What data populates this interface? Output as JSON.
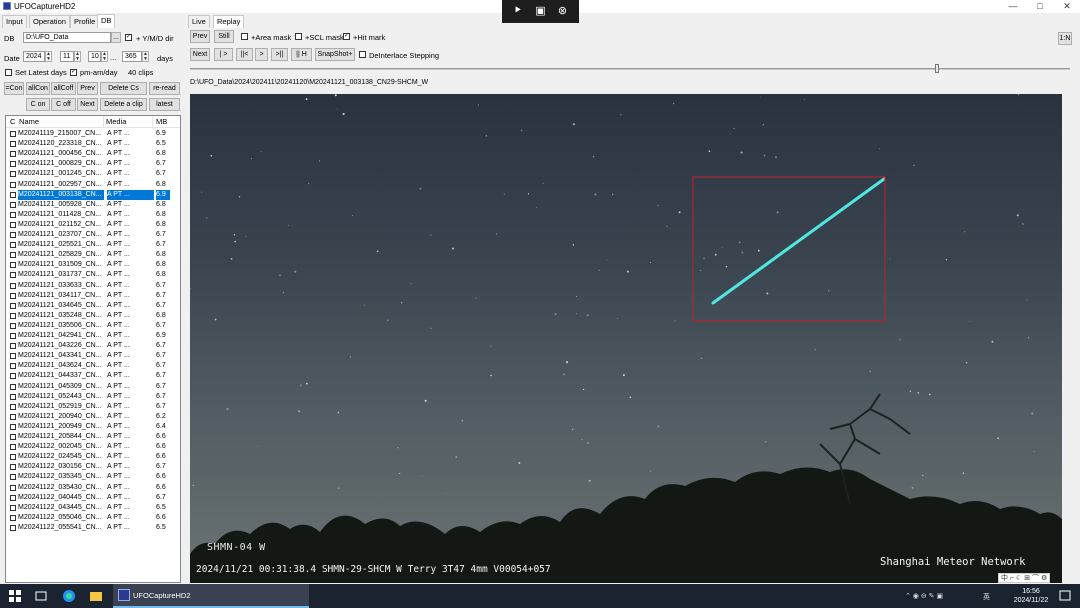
{
  "window": {
    "title": "UFOCaptureHD2",
    "min": "—",
    "max": "□",
    "close": "✕"
  },
  "recorder": {
    "icon1": "cursor-icon",
    "icon2": "screen-icon",
    "icon3": "close-icon"
  },
  "left_tabs": [
    "Input",
    "Operation",
    "Profile",
    "DB"
  ],
  "db": {
    "db_label": "DB",
    "db_path": "D:\\UFO_Data",
    "browse": "...",
    "ymd_dir_label": "+ Y/M/D dir",
    "ymd_dir_checked": "✓",
    "date_label": "Date",
    "year": "2024",
    "month": "11",
    "day": "10",
    "ellipsis": "...",
    "days_value": "365",
    "days_label": "days",
    "set_latest_label": "Set Latest days",
    "pm_am_label": "pm-am/day",
    "pm_am_checked": "✓",
    "clips": "40 clips"
  },
  "buttons": {
    "xcon": "=Con",
    "allcon": "allCon",
    "allcoff": "allCoff",
    "prev": "Prev",
    "delete_cs": "Delete Cs",
    "reread": "re-read",
    "con": "C on",
    "coff": "C off",
    "next": "Next",
    "delete_clip": "Delete a clip",
    "latest": "latest"
  },
  "filelist": {
    "headers": {
      "c": "C",
      "name": "Name",
      "media": "Media",
      "mb": "MB"
    },
    "rows": [
      {
        "name": "M20241119_215007_CN...",
        "media": "A  PT  ...",
        "mb": "6.9"
      },
      {
        "name": "M20241120_223318_CN...",
        "media": "A  PT  ...",
        "mb": "6.5"
      },
      {
        "name": "M20241121_000456_CN...",
        "media": "A  PT  ...",
        "mb": "6.8"
      },
      {
        "name": "M20241121_000829_CN...",
        "media": "A  PT  ...",
        "mb": "6.7"
      },
      {
        "name": "M20241121_001245_CN...",
        "media": "A  PT  ...",
        "mb": "6.7"
      },
      {
        "name": "M20241121_002957_CN...",
        "media": "A  PT  ...",
        "mb": "6.8"
      },
      {
        "name": "M20241121_003138_CN...",
        "media": "A  PT  ...",
        "mb": "6.9"
      },
      {
        "name": "M20241121_005928_CN...",
        "media": "A  PT  ...",
        "mb": "6.8"
      },
      {
        "name": "M20241121_011428_CN...",
        "media": "A  PT  ...",
        "mb": "6.8"
      },
      {
        "name": "M20241121_021152_CN...",
        "media": "A  PT  ...",
        "mb": "6.8"
      },
      {
        "name": "M20241121_023707_CN...",
        "media": "A  PT  ...",
        "mb": "6.7"
      },
      {
        "name": "M20241121_025521_CN...",
        "media": "A  PT  ...",
        "mb": "6.7"
      },
      {
        "name": "M20241121_025829_CN...",
        "media": "A  PT  ...",
        "mb": "6.8"
      },
      {
        "name": "M20241121_031509_CN...",
        "media": "A  PT  ...",
        "mb": "6.8"
      },
      {
        "name": "M20241121_031737_CN...",
        "media": "A  PT  ...",
        "mb": "6.8"
      },
      {
        "name": "M20241121_033633_CN...",
        "media": "A  PT  ...",
        "mb": "6.7"
      },
      {
        "name": "M20241121_034117_CN...",
        "media": "A  PT  ...",
        "mb": "6.7"
      },
      {
        "name": "M20241121_034645_CN...",
        "media": "A  PT  ...",
        "mb": "6.7"
      },
      {
        "name": "M20241121_035248_CN...",
        "media": "A  PT  ...",
        "mb": "6.8"
      },
      {
        "name": "M20241121_035506_CN...",
        "media": "A  PT  ...",
        "mb": "6.7"
      },
      {
        "name": "M20241121_042941_CN...",
        "media": "A  PT  ...",
        "mb": "6.9"
      },
      {
        "name": "M20241121_043226_CN...",
        "media": "A  PT  ...",
        "mb": "6.7"
      },
      {
        "name": "M20241121_043341_CN...",
        "media": "A  PT  ...",
        "mb": "6.7"
      },
      {
        "name": "M20241121_043624_CN...",
        "media": "A  PT  ...",
        "mb": "6.7"
      },
      {
        "name": "M20241121_044337_CN...",
        "media": "A  PT  ...",
        "mb": "6.7"
      },
      {
        "name": "M20241121_045309_CN...",
        "media": "A  PT  ...",
        "mb": "6.7"
      },
      {
        "name": "M20241121_052443_CN...",
        "media": "A  PT  ...",
        "mb": "6.7"
      },
      {
        "name": "M20241121_052919_CN...",
        "media": "A  PT  ...",
        "mb": "6.7"
      },
      {
        "name": "M20241121_200940_CN...",
        "media": "A  PT  ...",
        "mb": "6.2"
      },
      {
        "name": "M20241121_200949_CN...",
        "media": "A  PT  ...",
        "mb": "6.4"
      },
      {
        "name": "M20241121_205844_CN...",
        "media": "A  PT  ...",
        "mb": "6.6"
      },
      {
        "name": "M20241122_002045_CN...",
        "media": "A  PT  ...",
        "mb": "6.6"
      },
      {
        "name": "M20241122_024545_CN...",
        "media": "A  PT  ...",
        "mb": "6.6"
      },
      {
        "name": "M20241122_030156_CN...",
        "media": "A  PT  ...",
        "mb": "6.7"
      },
      {
        "name": "M20241122_035345_CN...",
        "media": "A  PT  ...",
        "mb": "6.6"
      },
      {
        "name": "M20241122_035430_CN...",
        "media": "A  PT  ...",
        "mb": "6.6"
      },
      {
        "name": "M20241122_040445_CN...",
        "media": "A  PT  ...",
        "mb": "6.7"
      },
      {
        "name": "M20241122_043445_CN...",
        "media": "A  PT  ...",
        "mb": "6.5"
      },
      {
        "name": "M20241122_055046_CN...",
        "media": "A  PT  ...",
        "mb": "6.6"
      },
      {
        "name": "M20241122_055541_CN...",
        "media": "A  PT  ...",
        "mb": "6.5"
      }
    ],
    "selected_index": 6
  },
  "right_tabs": [
    "Live",
    "Replay"
  ],
  "replay": {
    "prev": "Prev",
    "still": "Still",
    "area_mask": "+Area mask",
    "scl_mask": "+SCL mask",
    "hit_mark": "+Hit mark",
    "hit_checked": "✓",
    "next": "Next",
    "play": "| >",
    "back_start": "||<",
    "fwd": ">",
    "fwd_end": ">||",
    "hold": "|| H",
    "snapshot": "SnapShot+",
    "deinterlace": "DeInterlace Stepping",
    "zoom": "1:N"
  },
  "clip_path": "D:\\UFO_Data\\2024\\202411\\20241120\\M20241121_003138_CN29-SHCM_W",
  "video": {
    "camera_label": "SHMN-04 W",
    "info_line": "2024/11/21 00:31:38.4 SHMN-29-SHCM W Terry 3T47 4mm V00054+057",
    "network": "Shanghai Meteor Network",
    "box_color": "#c0202a",
    "meteor_color": "#4fe8e0"
  },
  "ime": "中 ⌐ ☾ ⊞ ⌒ ⚙",
  "taskbar": {
    "app_label": "UFOCaptureHD2",
    "time": "16:56",
    "date": "2024/11/22",
    "tray_text": "英"
  }
}
